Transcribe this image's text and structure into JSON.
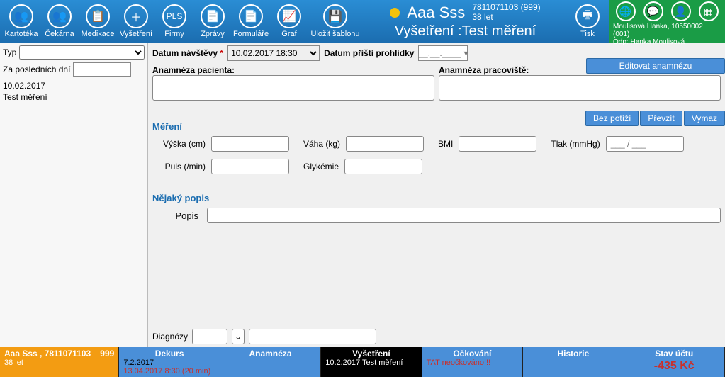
{
  "toolbar": {
    "kartoteka": "Kartotéka",
    "cekarna": "Čekárna",
    "medikace": "Medikace",
    "vysetreni": "Vyšetření",
    "firmy": "Firmy",
    "zpravy": "Zprávy",
    "formulare": "Formuláře",
    "graf": "Graf",
    "ulozit": "Uložit šablonu",
    "tisk": "Tisk",
    "pls": "PLS"
  },
  "patient": {
    "name": "Aaa Sss",
    "id": "7811071103 (999)",
    "age": "38 let",
    "title": "Vyšetření :Test měření"
  },
  "user": {
    "line1": "Moulisová Hanka, 10550002 (001)",
    "odp_label": "Odp:",
    "odp_link": "Hanka Moulisová"
  },
  "left": {
    "typ": "Typ",
    "za_poslednich": "Za posledních dní",
    "visit_date": "10.02.2017",
    "visit_name": "Test měření"
  },
  "main": {
    "datum_navstevy": "Datum návštěvy",
    "datum_value": "10.02.2017 18:30",
    "datum_pristi": "Datum příští prohlídky",
    "datum_pristi_placeholder": "__.__.____",
    "anam_pacient": "Anamnéza pacienta:",
    "anam_prac": "Anamnéza pracoviště:",
    "editovat": "Editovat anamnézu",
    "bez_potizi": "Bez potíží",
    "prevzit": "Převzít",
    "vymazat": "Vymaz",
    "mereni": "Měření",
    "vyska": "Výška (cm)",
    "vaha": "Váha (kg)",
    "bmi": "BMI",
    "tlak": "Tlak (mmHg)",
    "tlak_placeholder": "___ / ___",
    "puls": "Puls (/min)",
    "glykemie": "Glykémie",
    "nejaky_popis": "Nějaký popis",
    "popis": "Popis",
    "diagnozy": "Diagnózy"
  },
  "bottom": {
    "patient_label": "Aaa Sss ,  7811071103",
    "patient_right": "999",
    "patient_sub": "38 let",
    "dekurs": "Dekurs",
    "dekurs_sub1": "7.2.2017",
    "dekurs_sub2": "13.04.2017 8:30 (20 min)",
    "anamneza": "Anamnéza",
    "vysetreni": "Vyšetření",
    "vysetreni_sub": "10.2.2017 Test měření",
    "ockovani": "Očkování",
    "ockovani_sub": "TAT neočkováno!!!",
    "historie": "Historie",
    "stav_uctu": "Stav účtu",
    "stav_value": "-435 Kč"
  }
}
